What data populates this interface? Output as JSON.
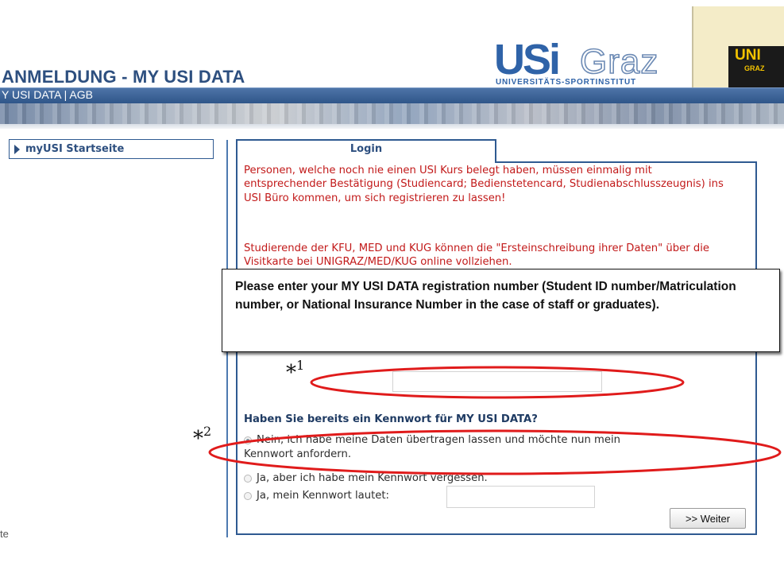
{
  "header": {
    "title": "ANMELDUNG - MY USI DATA",
    "nav_prefix": "Y USI DATA",
    "nav_separator": " | ",
    "nav_agb": "AGB"
  },
  "logos": {
    "usi_main": "USi",
    "usi_graz": "Graz",
    "usi_sub": "UNIVERSITÄTS-SPORTINSTITUT",
    "uni_main": "UNI",
    "uni_sub": "GRAZ"
  },
  "sidebar": {
    "item_label": "myUSI Startseite",
    "cut_text": "te"
  },
  "login": {
    "tab_label": "Login",
    "message_1": "Personen, welche noch nie einen USI Kurs belegt haben, müssen einmalig mit entsprechender Bestätigung (Studiencard; Bedienstetencard, Studienabschlusszeugnis) ins USI Büro kommen, um sich registrieren zu lassen!",
    "message_2": "Studierende der KFU, MED und KUG können die \"Ersteinschreibung ihrer Daten\" über die Visitkarte bei UNIGRAZ/MED/KUG online vollziehen.",
    "question": "Haben Sie bereits ein Kennwort für MY USI DATA?",
    "option_1_line1": "Nein, ich habe meine Daten übertragen lassen und möchte nun mein",
    "option_1_line2": "Kennwort anfordern.",
    "option_2": "Ja, aber ich habe mein Kennwort vergessen.",
    "option_3": "Ja, mein Kennwort lautet:",
    "submit_label": ">> Weiter"
  },
  "annotation": {
    "callout_text": "Please enter your MY USI DATA registration number (Student ID number/Matriculation number, or National Insurance Number in the case of staff or graduates).",
    "marker_1": "*",
    "marker_1_num": "1",
    "marker_2": "*",
    "marker_2_num": "2",
    "oval_color": "#e01b1b"
  }
}
